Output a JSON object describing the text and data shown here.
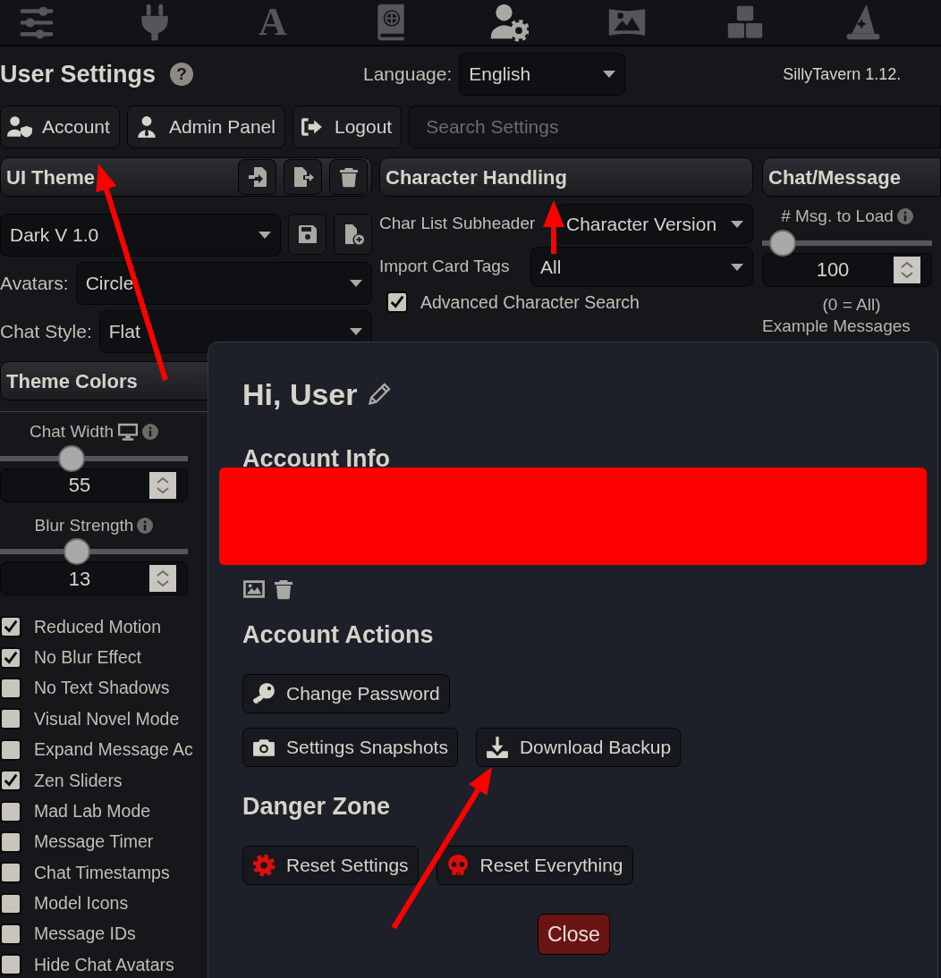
{
  "nav": [
    {
      "kind": "sliders",
      "selected": false
    },
    {
      "kind": "plug",
      "selected": false
    },
    {
      "kind": "font",
      "label": "A",
      "selected": false
    },
    {
      "kind": "book",
      "selected": false
    },
    {
      "kind": "user-gear",
      "selected": true
    },
    {
      "kind": "image",
      "selected": false
    },
    {
      "kind": "cubes",
      "selected": false
    },
    {
      "kind": "hat",
      "selected": false
    }
  ],
  "header": {
    "title": "User Settings",
    "help": "?",
    "language_label": "Language:",
    "language": "English",
    "version": "SillyTavern 1.12."
  },
  "toolbar": {
    "buttons": [
      {
        "kind": "account",
        "label": "Account"
      },
      {
        "kind": "admin",
        "label": "Admin Panel"
      },
      {
        "kind": "logout",
        "label": "Logout"
      }
    ],
    "search": {
      "placeholder": "Search Settings"
    }
  },
  "ui_theme": {
    "title": "UI Theme",
    "theme": "Dark V 1.0",
    "fields": [
      {
        "label": "Avatars:",
        "value": "Circle"
      },
      {
        "label": "Chat Style:",
        "value": "Flat"
      }
    ]
  },
  "theme_colors": {
    "title": "Theme Colors",
    "sliders": [
      {
        "label": "Chat Width",
        "monitor_icon": true,
        "level": 0.38,
        "value": "55"
      },
      {
        "label": "Blur Strength",
        "monitor_icon": false,
        "level": 0.41,
        "value": "13"
      }
    ],
    "checkboxes": [
      {
        "label": "Reduced Motion",
        "checked": true
      },
      {
        "label": "No Blur Effect",
        "checked": true
      },
      {
        "label": "No Text Shadows",
        "checked": false
      },
      {
        "label": "Visual Novel Mode",
        "checked": false
      },
      {
        "label": "Expand Message Ac",
        "checked": false
      },
      {
        "label": "Zen Sliders",
        "checked": true
      },
      {
        "label": "Mad Lab Mode",
        "checked": false
      },
      {
        "label": "Message Timer",
        "checked": false
      },
      {
        "label": "Chat Timestamps",
        "checked": false
      },
      {
        "label": "Model Icons",
        "checked": false
      },
      {
        "label": "Message IDs",
        "checked": false
      },
      {
        "label": "Hide Chat Avatars",
        "checked": false
      }
    ]
  },
  "character_handling": {
    "title": "Character Handling",
    "fields": [
      {
        "label": "Char List Subheader",
        "value": "Character Version"
      },
      {
        "label": "Import Card Tags",
        "value": "All"
      }
    ],
    "checkboxes": [
      {
        "label": "Advanced Character Search",
        "checked": true
      }
    ]
  },
  "chat_message": {
    "title": "Chat/Message",
    "slider": {
      "label": "# Msg. to Load",
      "level": 0.12,
      "value": "100",
      "note": "(0 = All)"
    },
    "next_label": "Example Messages"
  },
  "modal": {
    "greeting": "Hi, User",
    "account_info": {
      "title": "Account Info"
    },
    "account_actions": {
      "title": "Account Actions",
      "rows": [
        [
          {
            "kind": "key",
            "label": "Change Password"
          }
        ],
        [
          {
            "kind": "camera",
            "label": "Settings Snapshots"
          },
          {
            "kind": "download",
            "label": "Download Backup"
          }
        ]
      ]
    },
    "danger_zone": {
      "title": "Danger Zone",
      "buttons": [
        {
          "kind": "gear",
          "label": "Reset Settings"
        },
        {
          "kind": "skull",
          "label": "Reset Everything"
        }
      ]
    },
    "close": "Close"
  }
}
